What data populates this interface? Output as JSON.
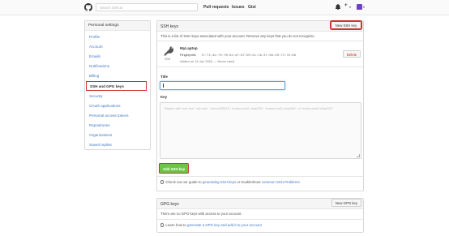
{
  "header": {
    "search_placeholder": "Search GitHub",
    "nav": [
      "Pull requests",
      "Issues",
      "Gist"
    ],
    "icons": [
      "github-logo-icon",
      "bell-icon",
      "plus-icon",
      "avatar-icon"
    ]
  },
  "sidebar": {
    "title": "Personal settings",
    "items": [
      {
        "label": "Profile"
      },
      {
        "label": "Account"
      },
      {
        "label": "Emails"
      },
      {
        "label": "Notifications"
      },
      {
        "label": "Billing"
      },
      {
        "label": "SSH and GPG keys"
      },
      {
        "label": "Security"
      },
      {
        "label": "OAuth applications"
      },
      {
        "label": "Personal access tokens"
      },
      {
        "label": "Repositories"
      },
      {
        "label": "Organizations"
      },
      {
        "label": "Saved replies"
      }
    ]
  },
  "ssh": {
    "title": "SSH keys",
    "new_button": "New SSH key",
    "description": "This is a list of SSH keys associated with your account. Remove any keys that you do not recognize.",
    "key": {
      "name": "MyLaptop",
      "badge": "SSH",
      "fingerprint_label": "Fingerprint:",
      "fingerprint": "1f:71:4e:f5:f6:82:af:67:09:d1:1b:5f:0d:49:73:f0:b0",
      "added": "Added on 15 Jun 2016 — Never used",
      "delete_button": "Delete"
    },
    "form": {
      "title_label": "Title",
      "title_value": "",
      "key_label": "Key",
      "key_placeholder": "Begins with 'ssh-rsa', 'ssh-dss', 'ssh-ed25519', 'ecdsa-sha2-nistp256', 'ecdsa-sha2-nistp384', or 'ecdsa-sha2-nistp521'",
      "add_button": "Add SSH key"
    },
    "help": {
      "prefix": "Check out our guide to",
      "link1": "generating SSH keys",
      "middle": "or troubleshoot",
      "link2": "common SSH Problems"
    }
  },
  "gpg": {
    "title": "GPG keys",
    "new_button": "New GPG key",
    "empty": "There are no GPG keys with access to your account.",
    "help_prefix": "Learn how to",
    "help_link": "generate a GPG key and add it to your account"
  },
  "colors": {
    "accent_link": "#4078c0",
    "primary_button": "#6cc644",
    "highlight_outline": "#cc3333",
    "delete_text": "#bd2c00"
  }
}
